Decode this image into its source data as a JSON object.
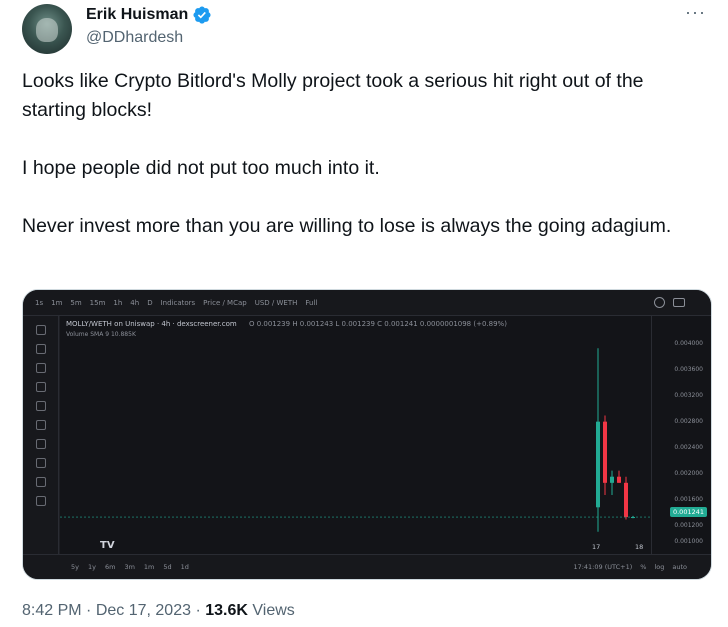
{
  "author": {
    "display_name": "Erik Huisman",
    "handle": "@DDhardesh",
    "verified": true,
    "avatar": "avatar-image"
  },
  "tweet": {
    "paragraphs": [
      "Looks like Crypto Bitlord's Molly project took a serious hit right out of the starting blocks!",
      "I hope people did not put too much into it.",
      "Never invest more than you are willing to lose is always the going adagium."
    ]
  },
  "meta": {
    "time": "8:42 PM",
    "separator": " · ",
    "date": "Dec 17, 2023",
    "views_count": "13.6K",
    "views_label": "Views"
  },
  "media": {
    "toolbar_items": [
      "1s",
      "1m",
      "5m",
      "15m",
      "1h",
      "4h",
      "D",
      "Indicators",
      "Price / MCap",
      "USD / WETH",
      "Full"
    ],
    "legend": "MOLLY/WETH on Uniswap · 4h · dexscreener.com",
    "ohlc": "O 0.001239  H 0.001243  L 0.001239  C 0.001241  0.0000001098 (+0.89%)",
    "volume_label": "Volume  SMA 9   10.885K",
    "price_ticks": [
      "0.004000",
      "0.003600",
      "0.003200",
      "0.002800",
      "0.002400",
      "0.002000",
      "0.001600",
      "0.001200",
      "0.001000"
    ],
    "last_price": "0.001241",
    "x_labels": [
      "17",
      "18"
    ],
    "bottom_ranges": [
      "5y",
      "1y",
      "6m",
      "3m",
      "1m",
      "5d",
      "1d"
    ],
    "bottom_right": [
      "17:41:09 (UTC+1)",
      "%",
      "log",
      "auto"
    ],
    "logo_text": "TV",
    "colors": {
      "up": "#22ab94",
      "down": "#f23645",
      "background": "#131418"
    },
    "candles": [
      {
        "o": 0.0014,
        "h": 0.004,
        "l": 0.001,
        "c": 0.0028
      },
      {
        "o": 0.0028,
        "h": 0.0029,
        "l": 0.0016,
        "c": 0.0018
      },
      {
        "o": 0.0018,
        "h": 0.002,
        "l": 0.0016,
        "c": 0.0019
      },
      {
        "o": 0.0019,
        "h": 0.002,
        "l": 0.0018,
        "c": 0.0018
      },
      {
        "o": 0.0018,
        "h": 0.0019,
        "l": 0.0012,
        "c": 0.00124
      },
      {
        "o": 0.00124,
        "h": 0.00126,
        "l": 0.00122,
        "c": 0.001241
      }
    ]
  }
}
